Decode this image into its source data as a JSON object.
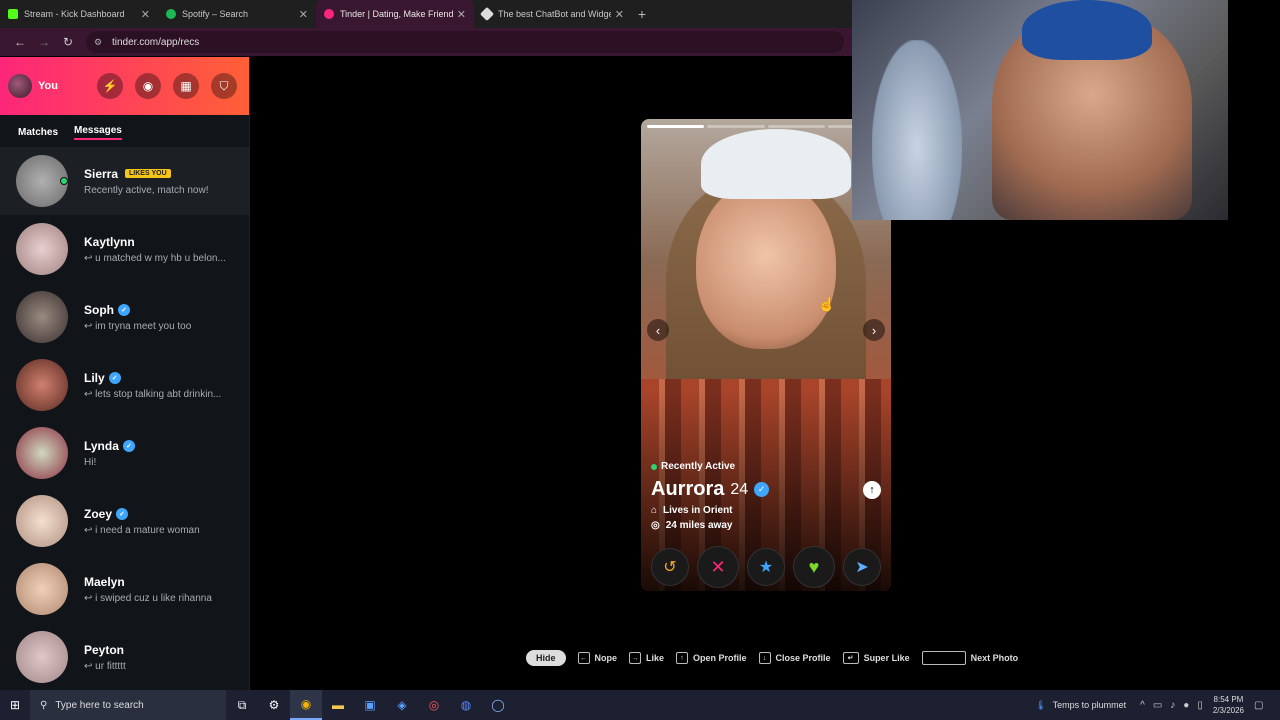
{
  "browser": {
    "tabs": [
      {
        "title": "Stream - Kick Dashboard",
        "color": "#53fc18"
      },
      {
        "title": "Spotify – Search",
        "color": "#1db954"
      },
      {
        "title": "Tinder | Dating, Make Friends &",
        "color": "#fd267a"
      },
      {
        "title": "The best ChatBot and Widgets",
        "color": "#dddddd"
      }
    ],
    "new_tab": "+",
    "url": "tinder.com/app/recs"
  },
  "sidebar": {
    "you_label": "You",
    "tabs": [
      "Matches",
      "Messages"
    ],
    "messages": [
      {
        "name": "Sierra",
        "badge": "LIKES YOU",
        "preview": "Recently active, match now!",
        "verified": false,
        "online": true,
        "avatar_color": "#8a8a8a"
      },
      {
        "name": "Kaytlynn",
        "preview": "↩ u matched w my hb u belon...",
        "verified": false,
        "avatar_color": "#d8b8b8"
      },
      {
        "name": "Soph",
        "preview": "↩ im tryna meet you too",
        "verified": true,
        "avatar_color": "#6a5a5a"
      },
      {
        "name": "Lily",
        "preview": "↩ lets stop talking abt drinkin...",
        "verified": true,
        "avatar_color": "#a05a4a"
      },
      {
        "name": "Lynda",
        "preview": "Hi!",
        "verified": true,
        "avatar_color": "#b04050"
      },
      {
        "name": "Zoey",
        "preview": "↩ i need a mature woman",
        "verified": true,
        "avatar_color": "#e0c8b8"
      },
      {
        "name": "Maelyn",
        "preview": "↩ i swiped cuz u like rihanna",
        "verified": false,
        "avatar_color": "#d0a890"
      },
      {
        "name": "Peyton",
        "preview": "↩ ur fittttt",
        "verified": false,
        "avatar_color": "#c8a8a8"
      }
    ]
  },
  "card": {
    "status": "Recently Active",
    "name": "Aurrora",
    "age": "24",
    "lives": "Lives in Orient",
    "distance": "24 miles away",
    "photos_total": 4,
    "photo_index": 1
  },
  "action_icons": [
    "rewind-icon",
    "nope-icon",
    "super-like-icon",
    "like-icon",
    "boost-icon"
  ],
  "shortcuts": {
    "hide": "Hide",
    "nope": "Nope",
    "like": "Like",
    "open_profile": "Open Profile",
    "close_profile": "Close Profile",
    "super_like": "Super Like",
    "next_photo": "Next Photo"
  },
  "taskbar": {
    "search_placeholder": "Type here to search",
    "weather": "Temps to plummet",
    "time": "8:54 PM",
    "date": "2/3/2026"
  }
}
